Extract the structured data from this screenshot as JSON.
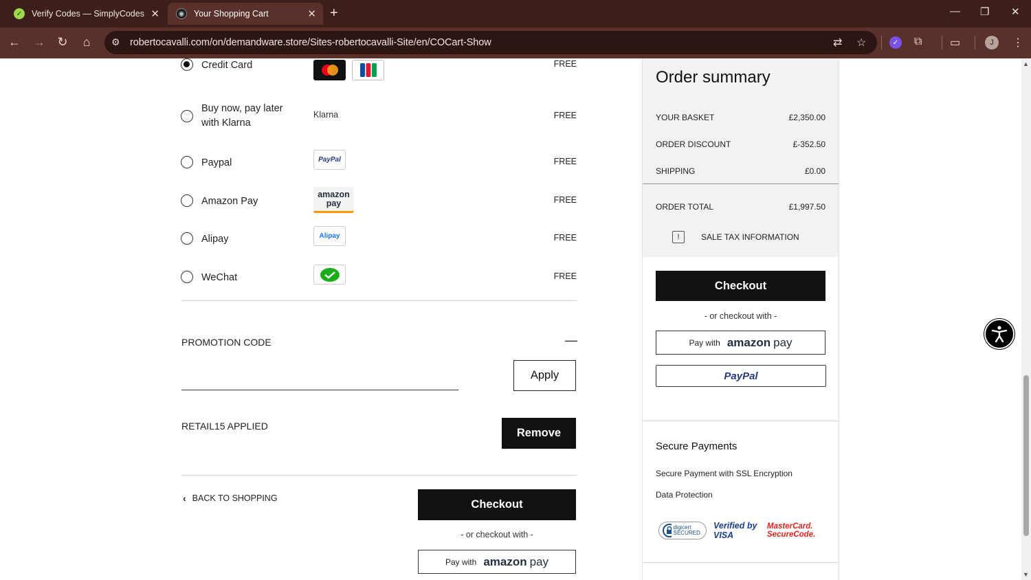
{
  "browser": {
    "tabs": [
      {
        "title": "Verify Codes — SimplyCodes",
        "active": false
      },
      {
        "title": "Your Shopping Cart",
        "active": true
      }
    ],
    "url": "robertocavalli.com/on/demandware.store/Sites-robertocavalli-Site/en/COCart-Show",
    "profile_initial": "J"
  },
  "payment_methods": [
    {
      "label": "Credit Card",
      "price": "FREE",
      "selected": true,
      "logo": "mastercard-jcb"
    },
    {
      "label": "Buy now, pay later with Klarna",
      "price": "FREE",
      "selected": false,
      "logo": "Klarna"
    },
    {
      "label": "Paypal",
      "price": "FREE",
      "selected": false,
      "logo": "PayPal"
    },
    {
      "label": "Amazon Pay",
      "price": "FREE",
      "selected": false,
      "logo": "amazon pay"
    },
    {
      "label": "Alipay",
      "price": "FREE",
      "selected": false,
      "logo": "Alipay"
    },
    {
      "label": "WeChat",
      "price": "FREE",
      "selected": false,
      "logo": "wechat"
    }
  ],
  "promotion": {
    "title": "PROMOTION CODE",
    "toggle": "—",
    "input_value": "",
    "apply_label": "Apply",
    "applied_text": "RETAIL15 APPLIED",
    "remove_label": "Remove"
  },
  "footer_actions": {
    "back_label": "BACK TO SHOPPING",
    "checkout_label": "Checkout",
    "or_text": "- or checkout with -",
    "amazon_pay_with": "Pay with",
    "amazon_word": "amazon",
    "amazon_pay": "pay"
  },
  "summary": {
    "title": "Order summary",
    "rows": [
      {
        "label": "YOUR BASKET",
        "value": "£2,350.00"
      },
      {
        "label": "ORDER DISCOUNT",
        "value": "£-352.50"
      },
      {
        "label": "SHIPPING",
        "value": "£0.00"
      }
    ],
    "total_label": "ORDER TOTAL",
    "total_value": "£1,997.50",
    "tax_info": "SALE TAX INFORMATION",
    "checkout_label": "Checkout",
    "or_text": "- or checkout with -",
    "paypal_label": "PayPal"
  },
  "secure": {
    "title": "Secure Payments",
    "lines": [
      "Secure Payment with SSL Encryption",
      "Data Protection"
    ],
    "badges": [
      "digicert SECURED",
      "Verified by VISA",
      "MasterCard. SecureCode."
    ]
  },
  "colors": {
    "chrome_dark": "#3c1f1a",
    "chrome_mid": "#5a302a",
    "button_black": "#121212",
    "summary_bg": "#f2f2f2"
  }
}
